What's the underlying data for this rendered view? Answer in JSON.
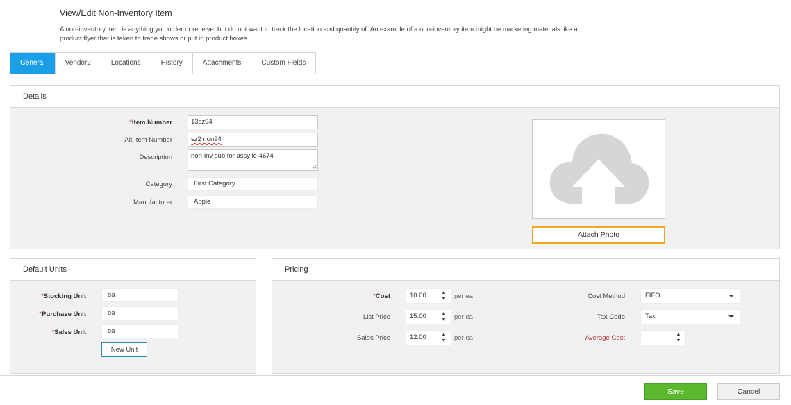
{
  "page": {
    "title": "View/Edit Non-Inventory Item",
    "description": "A non-inventory item is anything you order or receive, but do not want to track the location and quantity of. An example of a non-inventory item might be marketing materials like a product flyer that is taken to trade shows or put in product boxes."
  },
  "tabs": [
    {
      "label": "General",
      "active": true
    },
    {
      "label": "Vendor2",
      "active": false
    },
    {
      "label": "Locations",
      "active": false
    },
    {
      "label": "History",
      "active": false
    },
    {
      "label": "Attachments",
      "active": false
    },
    {
      "label": "Custom Fields",
      "active": false
    }
  ],
  "details": {
    "heading": "Details",
    "item_number_label": "Item Number",
    "item_number": "13sz94",
    "alt_item_number_label": "Alt Item Number",
    "alt_item_number": "sz2 non94",
    "description_label": "Description",
    "description": "non-inv sub for assy ic-4674",
    "category_label": "Category",
    "category": "First Category",
    "manufacturer_label": "Manufacturer",
    "manufacturer": "Apple",
    "attach_photo": "Attach Photo",
    "required_mark": "*"
  },
  "units": {
    "heading": "Default Units",
    "stocking_label": "Stocking Unit",
    "stocking": "ea",
    "purchase_label": "Purchase Unit",
    "purchase": "ea",
    "sales_label": "Sales Unit",
    "sales": "ea",
    "new_unit": "New Unit"
  },
  "pricing": {
    "heading": "Pricing",
    "cost_label": "Cost",
    "cost": "10.00",
    "list_price_label": "List Price",
    "list_price": "15.00",
    "sales_price_label": "Sales Price",
    "sales_price": "12.00",
    "per_unit": "per ea",
    "cost_method_label": "Cost Method",
    "cost_method": "FIFO",
    "tax_code_label": "Tax Code",
    "tax_code": "Tax",
    "average_cost_label": "Average Cost",
    "average_cost": ""
  },
  "footer": {
    "save": "Save",
    "cancel": "Cancel"
  },
  "colors": {
    "active_tab": "#1a9ee8",
    "save_button": "#5cb82e",
    "attach_border": "#f0a821",
    "required": "#c0392b"
  }
}
